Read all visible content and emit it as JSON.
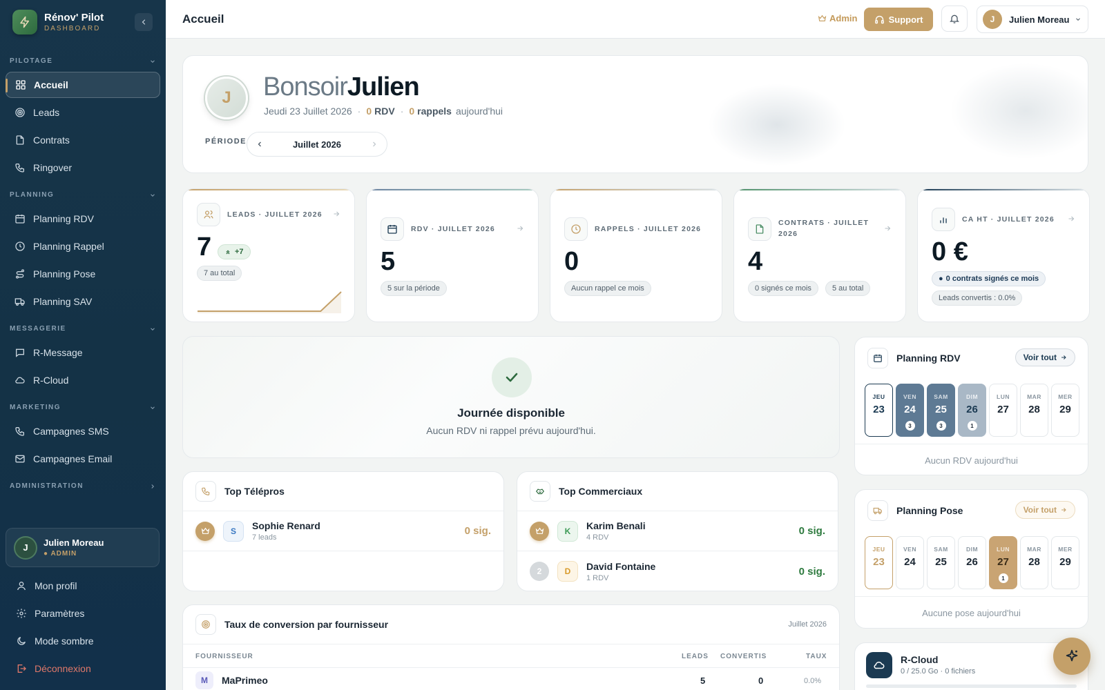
{
  "brand": {
    "name": "Rénov' Pilot",
    "sub": "DASHBOARD"
  },
  "sidebar": {
    "sections": [
      {
        "label": "PILOTAGE",
        "items": [
          {
            "label": "Accueil",
            "icon": "grid-icon",
            "active": true
          },
          {
            "label": "Leads",
            "icon": "target-icon"
          },
          {
            "label": "Contrats",
            "icon": "file-icon"
          },
          {
            "label": "Ringover",
            "icon": "phone-icon"
          }
        ]
      },
      {
        "label": "PLANNING",
        "items": [
          {
            "label": "Planning RDV",
            "icon": "calendar-icon"
          },
          {
            "label": "Planning Rappel",
            "icon": "clock-icon"
          },
          {
            "label": "Planning Pose",
            "icon": "route-icon"
          },
          {
            "label": "Planning SAV",
            "icon": "truck-icon"
          }
        ]
      },
      {
        "label": "MESSAGERIE",
        "items": [
          {
            "label": "R-Message",
            "icon": "message-icon"
          },
          {
            "label": "R-Cloud",
            "icon": "cloud-icon"
          }
        ]
      },
      {
        "label": "MARKETING",
        "items": [
          {
            "label": "Campagnes SMS",
            "icon": "phone-icon"
          },
          {
            "label": "Campagnes Email",
            "icon": "mail-icon"
          }
        ]
      },
      {
        "label": "ADMINISTRATION",
        "items": []
      }
    ],
    "user": {
      "initial": "J",
      "name": "Julien Moreau",
      "role": "ADMIN"
    },
    "bottom": [
      {
        "label": "Mon profil"
      },
      {
        "label": "Paramètres"
      },
      {
        "label": "Mode sombre"
      },
      {
        "label": "Déconnexion"
      }
    ]
  },
  "topbar": {
    "title": "Accueil",
    "admin": "Admin",
    "support": "Support",
    "user_initial": "J",
    "user_name": "Julien Moreau"
  },
  "hero": {
    "initial": "J",
    "greet1": "Bonsoir",
    "greet2": "Julien",
    "date": "Jeudi 23 Juillet 2026",
    "rdv_count": "0",
    "rdv_label": "RDV",
    "rappels_count": "0",
    "rappels_label": "rappels",
    "today": "aujourd'hui",
    "period_label": "PÉRIODE",
    "period_value": "Juillet 2026"
  },
  "stats": [
    {
      "label": "LEADS · JUILLET 2026",
      "value": "7",
      "delta": "+7",
      "pills": [
        "7 au total"
      ],
      "color": "#c4a069"
    },
    {
      "label": "RDV · JUILLET 2026",
      "value": "5",
      "pills": [
        "5 sur la période"
      ],
      "color": "#7e96ad"
    },
    {
      "label": "RAPPELS · JUILLET 2026",
      "value": "0",
      "pills": [
        "Aucun rappel ce mois"
      ],
      "color": "#c4a069"
    },
    {
      "label": "CONTRATS · JUILLET 2026",
      "value": "4",
      "pills": [
        "0 signés ce mois",
        "5 au total"
      ],
      "color": "#5a9a6a"
    },
    {
      "label": "CA HT · JUILLET 2026",
      "value": "0 €",
      "pills": [
        "0 contrats signés ce mois",
        "Leads convertis : 0.0%"
      ],
      "color": "#1b3a52"
    }
  ],
  "leads_trend": [
    0,
    0,
    0,
    0,
    0,
    0,
    0,
    7
  ],
  "dayfree": {
    "title": "Journée disponible",
    "sub": "Aucun RDV ni rappel prévu aujourd'hui."
  },
  "top_telepros": {
    "title": "Top Télépros",
    "rows": [
      {
        "initial": "S",
        "name": "Sophie Renard",
        "sub": "7 leads",
        "sig": "0 sig."
      }
    ]
  },
  "top_commerciaux": {
    "title": "Top Commerciaux",
    "rows": [
      {
        "rank": "1",
        "initial": "K",
        "name": "Karim Benali",
        "sub": "4 RDV",
        "sig": "0 sig."
      },
      {
        "rank": "2",
        "initial": "D",
        "name": "David Fontaine",
        "sub": "1 RDV",
        "sig": "0 sig."
      }
    ]
  },
  "conversion": {
    "title": "Taux de conversion par fournisseur",
    "period": "Juillet 2026",
    "headers": [
      "FOURNISSEUR",
      "LEADS",
      "CONVERTIS",
      "TAUX"
    ],
    "rows": [
      {
        "initial": "M",
        "name": "MaPrimeo",
        "leads": "5",
        "converted": "0",
        "rate": "0.0%"
      }
    ]
  },
  "planning_rdv": {
    "title": "Planning RDV",
    "voir": "Voir tout",
    "empty": "Aucun RDV aujourd'hui",
    "days": [
      {
        "w": "JEU",
        "n": "23",
        "count": "",
        "state": "today"
      },
      {
        "w": "VEN",
        "n": "24",
        "count": "3",
        "state": "busy"
      },
      {
        "w": "SAM",
        "n": "25",
        "count": "3",
        "state": "busy"
      },
      {
        "w": "DIM",
        "n": "26",
        "count": "1",
        "state": "light"
      },
      {
        "w": "LUN",
        "n": "27",
        "count": "",
        "state": ""
      },
      {
        "w": "MAR",
        "n": "28",
        "count": "",
        "state": ""
      },
      {
        "w": "MER",
        "n": "29",
        "count": "",
        "state": ""
      }
    ]
  },
  "planning_pose": {
    "title": "Planning Pose",
    "voir": "Voir tout",
    "empty": "Aucune pose aujourd'hui",
    "days": [
      {
        "w": "JEU",
        "n": "23",
        "count": "",
        "state": "today"
      },
      {
        "w": "VEN",
        "n": "24",
        "count": "",
        "state": ""
      },
      {
        "w": "SAM",
        "n": "25",
        "count": "",
        "state": ""
      },
      {
        "w": "DIM",
        "n": "26",
        "count": "",
        "state": ""
      },
      {
        "w": "LUN",
        "n": "27",
        "count": "1",
        "state": "busy"
      },
      {
        "w": "MAR",
        "n": "28",
        "count": "",
        "state": ""
      },
      {
        "w": "MER",
        "n": "29",
        "count": "",
        "state": ""
      }
    ]
  },
  "rcloud": {
    "title": "R-Cloud",
    "sub": "0 / 25.0 Go · 0 fichiers",
    "usage": 0
  }
}
